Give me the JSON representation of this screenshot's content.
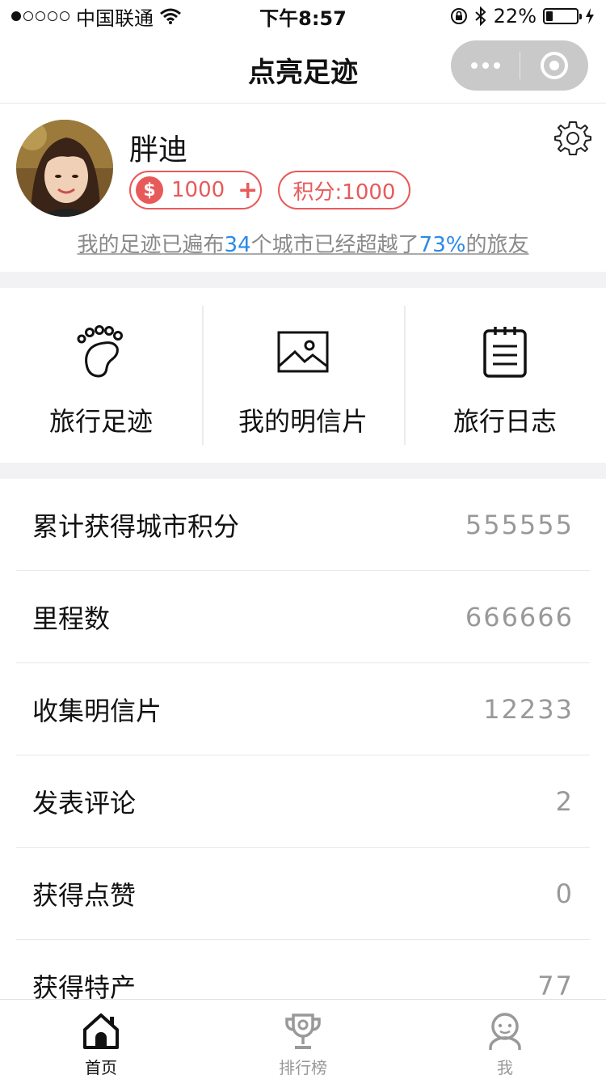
{
  "status_bar": {
    "carrier": "中国联通",
    "time": "下午8:57",
    "battery": "22%",
    "battery_level": 0.22
  },
  "nav": {
    "title": "点亮足迹"
  },
  "profile": {
    "username": "胖迪",
    "coins": "1000",
    "coin_symbol": "$",
    "coin_add": "+",
    "points": "积分:1000",
    "summary_prefix": "我的足迹已遍布",
    "city_count": "34",
    "summary_middle": "个城市已经超越了",
    "percent": "73%",
    "summary_suffix": "的旅友"
  },
  "actions": [
    {
      "label": "旅行足迹",
      "icon": "footprint-icon"
    },
    {
      "label": "我的明信片",
      "icon": "postcard-image-icon"
    },
    {
      "label": "旅行日志",
      "icon": "notebook-icon"
    }
  ],
  "stats": [
    {
      "label": "累计获得城市积分",
      "value": "555555"
    },
    {
      "label": "里程数",
      "value": "666666"
    },
    {
      "label": "收集明信片",
      "value": "12233"
    },
    {
      "label": "发表评论",
      "value": "2"
    },
    {
      "label": "获得点赞",
      "value": "0"
    },
    {
      "label": "获得特产",
      "value": "77"
    }
  ],
  "tabs": [
    {
      "label": "首页",
      "icon": "home-icon",
      "active": true
    },
    {
      "label": "排行榜",
      "icon": "trophy-icon",
      "active": false
    },
    {
      "label": "我",
      "icon": "user-icon",
      "active": false
    }
  ],
  "colors": {
    "accent_red": "#e85a5a",
    "highlight_blue": "#2b8ae6",
    "divider": "#f2f2f5"
  }
}
